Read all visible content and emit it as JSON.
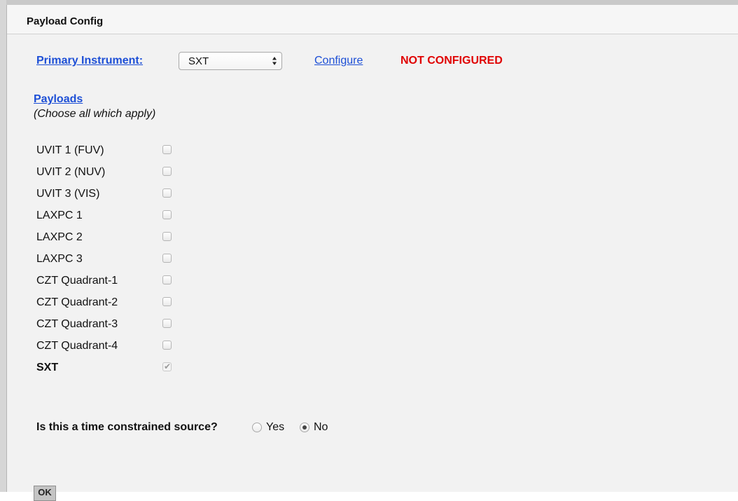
{
  "panel": {
    "title": "Payload Config"
  },
  "primary_instrument": {
    "label": "Primary Instrument:",
    "selected": "SXT",
    "configure_label": "Configure",
    "status": "NOT CONFIGURED",
    "status_color": "#e00000"
  },
  "payloads": {
    "heading": "Payloads",
    "hint": "(Choose all which apply)",
    "items": [
      {
        "label": "UVIT 1 (FUV)",
        "checked": false
      },
      {
        "label": "UVIT 2 (NUV)",
        "checked": false
      },
      {
        "label": "UVIT 3 (VIS)",
        "checked": false
      },
      {
        "label": "LAXPC 1",
        "checked": false
      },
      {
        "label": "LAXPC 2",
        "checked": false
      },
      {
        "label": "LAXPC 3",
        "checked": false
      },
      {
        "label": "CZT Quadrant-1",
        "checked": false
      },
      {
        "label": "CZT Quadrant-2",
        "checked": false
      },
      {
        "label": "CZT Quadrant-3",
        "checked": false
      },
      {
        "label": "CZT Quadrant-4",
        "checked": false
      },
      {
        "label": "SXT",
        "checked": true,
        "disabled": true
      }
    ]
  },
  "time_constraint": {
    "question": "Is this a time constrained source?",
    "yes_label": "Yes",
    "no_label": "No",
    "selected": "No"
  },
  "ok_button": {
    "label": "OK"
  },
  "colors": {
    "link": "#1d4fd6",
    "panel_bg": "#f2f2f2"
  }
}
